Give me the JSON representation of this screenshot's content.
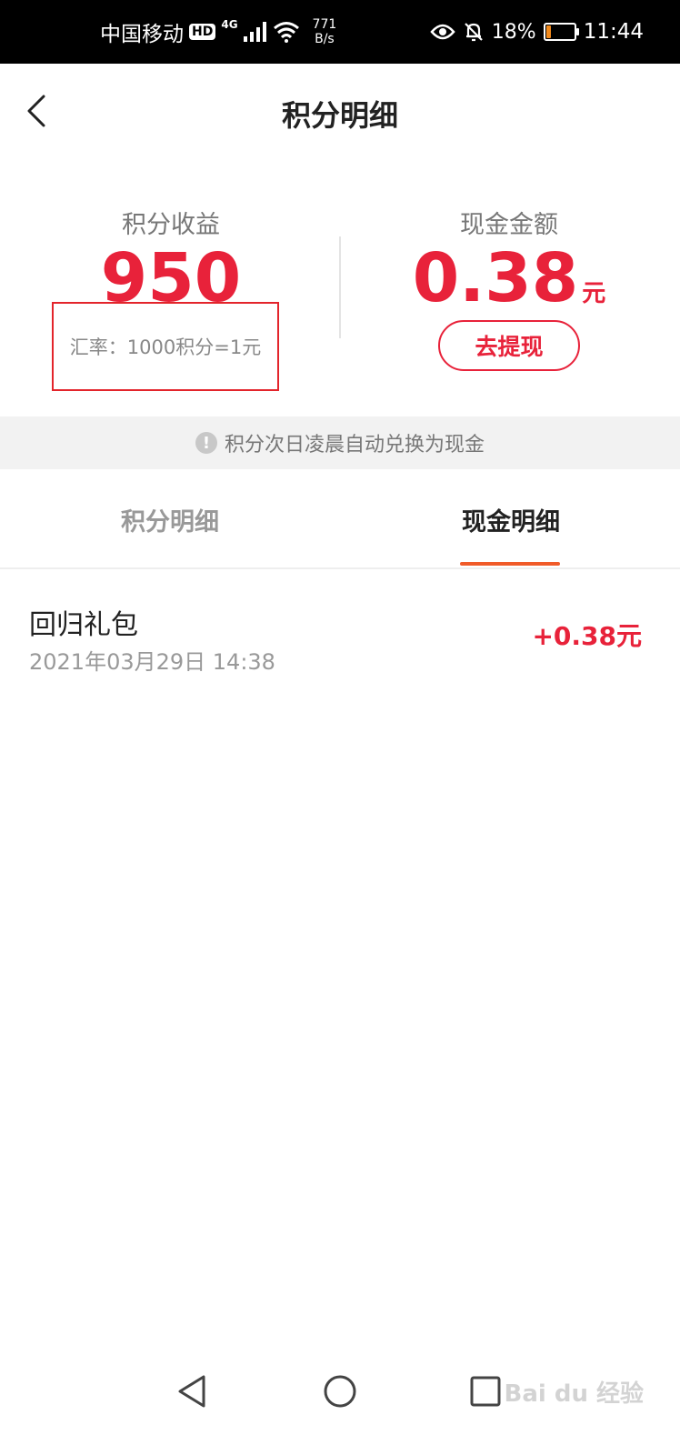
{
  "status_bar": {
    "carrier": "中国移动",
    "hd": "HD",
    "network": "4G",
    "speed_value": "771",
    "speed_unit": "B/s",
    "battery_percent": "18%",
    "battery_level": 0.18,
    "time": "11:44"
  },
  "header": {
    "title": "积分明细"
  },
  "summary": {
    "points_label": "积分收益",
    "points_value": "950",
    "rate_text": "汇率：1000积分=1元",
    "cash_label": "现金金额",
    "cash_value": "0.38",
    "cash_unit": "元",
    "withdraw_label": "去提现"
  },
  "notice": {
    "icon": "!",
    "text": "积分次日凌晨自动兑换为现金"
  },
  "tabs": {
    "points_label": "积分明细",
    "cash_label": "现金明细",
    "active": "cash"
  },
  "records": [
    {
      "title": "回归礼包",
      "time": "2021年03月29日 14:38",
      "amount": "+0.38元"
    }
  ],
  "colors": {
    "accent_red": "#e8223a",
    "tab_underline": "#f05a28",
    "highlight_box": "#e3242b"
  },
  "watermark": {
    "text": "Bai du 经验"
  }
}
